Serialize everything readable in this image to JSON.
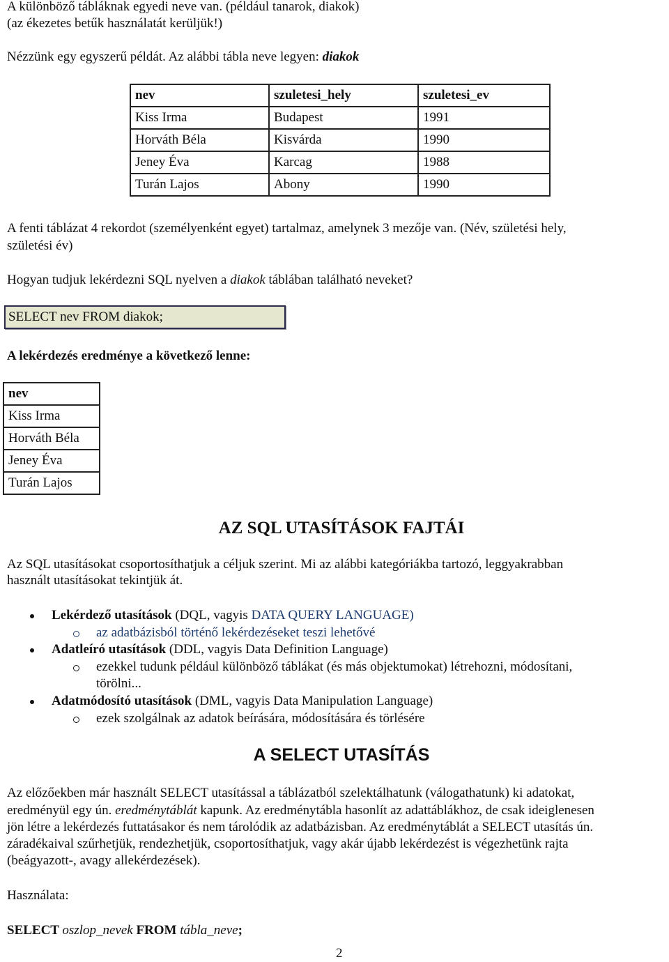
{
  "intro": {
    "line1": "A különböző tábláknak egyedi neve van. (például tanarok, diakok)",
    "line2": "(az ékezetes betűk használatát kerüljük!)",
    "example_prefix": "Nézzünk egy egyszerű példát. Az alábbi tábla neve legyen: ",
    "example_table_name": "diakok"
  },
  "diakok_table": {
    "headers": [
      "nev",
      "szuletesi_hely",
      "szuletesi_ev"
    ],
    "rows": [
      [
        "Kiss  Irma",
        "Budapest",
        "1991"
      ],
      [
        "Horváth Béla",
        "Kisvárda",
        "1990"
      ],
      [
        "Jeney Éva",
        "Karcag",
        "1988"
      ],
      [
        "Turán Lajos",
        "Abony",
        "1990"
      ]
    ]
  },
  "description": {
    "line1": " A fenti táblázat 4 rekordot (személyenként egyet) tartalmaz, amelynek 3 mezője van. (Név, születési hely,",
    "line2": "születési év)",
    "question_prefix": "Hogyan tudjuk lekérdezni SQL nyelven a ",
    "question_table": "diakok",
    "question_suffix": " táblában található neveket?"
  },
  "sql_example": {
    "code": "SELECT nev FROM diakok;",
    "background": "#e5e8cf"
  },
  "result": {
    "heading": "A lekérdezés eredménye a következő lenne:",
    "header": "nev",
    "rows": [
      "Kiss  Irma",
      "Horváth Béla",
      "Jeney Éva",
      "Turán Lajos"
    ]
  },
  "section_types": {
    "title": "AZ SQL UTASÍTÁSOK FAJTÁI",
    "intro_line1": "Az SQL utasításokat csoportosíthatjuk a céljuk szerint. Mi az alábbi kategóriákba tartozó, leggyakrabban",
    "intro_line2": "használt utasításokat tekintjük át.",
    "items": [
      {
        "bold": "Lekérdező utasítások",
        "rest_plain": " (DQL, vagyis ",
        "rest_blue": "DATA QUERY LANGUAGE)",
        "sub": [
          "az adatbázisból történő lekérdezéseket teszi  lehetővé"
        ]
      },
      {
        "bold": "Adatleíró utasítások",
        "rest_plain": " (DDL, vagyis Data Definition Language)",
        "sub": [
          "ezekkel tudunk például különböző táblákat (és más objektumokat) létrehozni, módosítani,",
          "törölni..."
        ]
      },
      {
        "bold": "Adatmódosító utasítások",
        "rest_plain": " (DML, vagyis Data Manipulation Language)",
        "sub": [
          "ezek szolgálnak az adatok  beírására, módosítására és törlésére"
        ]
      }
    ],
    "accent_color": "#1f3c6e"
  },
  "section_select": {
    "title": "A SELECT UTASÍTÁS",
    "p_line1": "Az előzőekben már használt SELECT utasítással a táblázatból szelektálhatunk (válogathatunk) ki adatokat,",
    "p_line2_a": "eredményül egy ún. ",
    "p_line2_it": "eredménytáblát",
    "p_line2_b": " kapunk. Az eredménytábla hasonlít az adattáblákhoz, de csak ideiglenesen",
    "p_line3": "jön létre a lekérdezés futtatásakor és nem tárolódik az adatbázisban. Az eredménytáblát a SELECT utasítás ún.",
    "p_line4": "záradékaival szűrhetjük, rendezhetjük, csoportosíthatjuk, vagy akár újabb lekérdezést is végezhetünk rajta",
    "p_line5": "(beágyazott-, avagy allekérdezések).",
    "usage_label": "Használata:",
    "syntax": {
      "kw1": "SELECT ",
      "arg1": "oszlop_nevek",
      "kw2": " FROM ",
      "arg2": "tábla_neve",
      "end": ";"
    }
  },
  "page_number": "2"
}
